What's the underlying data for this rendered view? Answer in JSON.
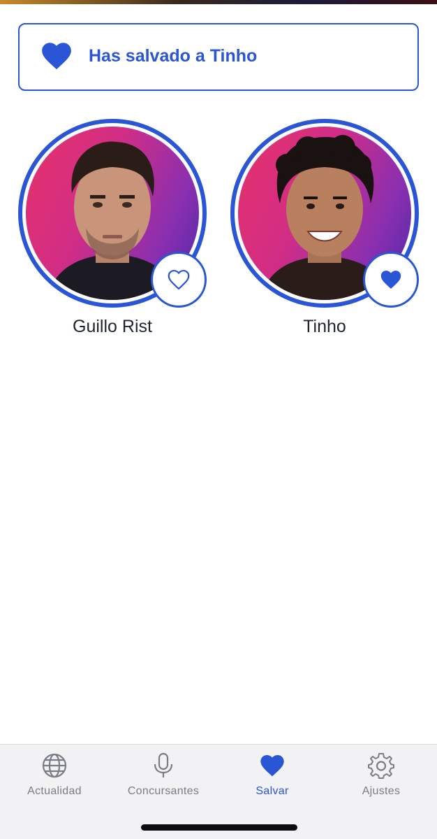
{
  "banner": {
    "icon": "heart-filled-icon",
    "text": "Has salvado a Tinho"
  },
  "contestants": [
    {
      "name": "Guillo Rist",
      "saved": false,
      "save_icon": "heart-outline-icon"
    },
    {
      "name": "Tinho",
      "saved": true,
      "save_icon": "heart-filled-icon"
    }
  ],
  "tabbar": {
    "active": "Salvar",
    "tabs": [
      {
        "label": "Actualidad",
        "icon": "globe-icon"
      },
      {
        "label": "Concursantes",
        "icon": "microphone-icon"
      },
      {
        "label": "Salvar",
        "icon": "heart-filled-icon"
      },
      {
        "label": "Ajustes",
        "icon": "gear-icon"
      }
    ]
  },
  "colors": {
    "accent": "#2a55d4",
    "inactive_tab": "#7a7d86",
    "name_text": "#1e2330",
    "tabbar_bg": "#f2f2f4"
  }
}
